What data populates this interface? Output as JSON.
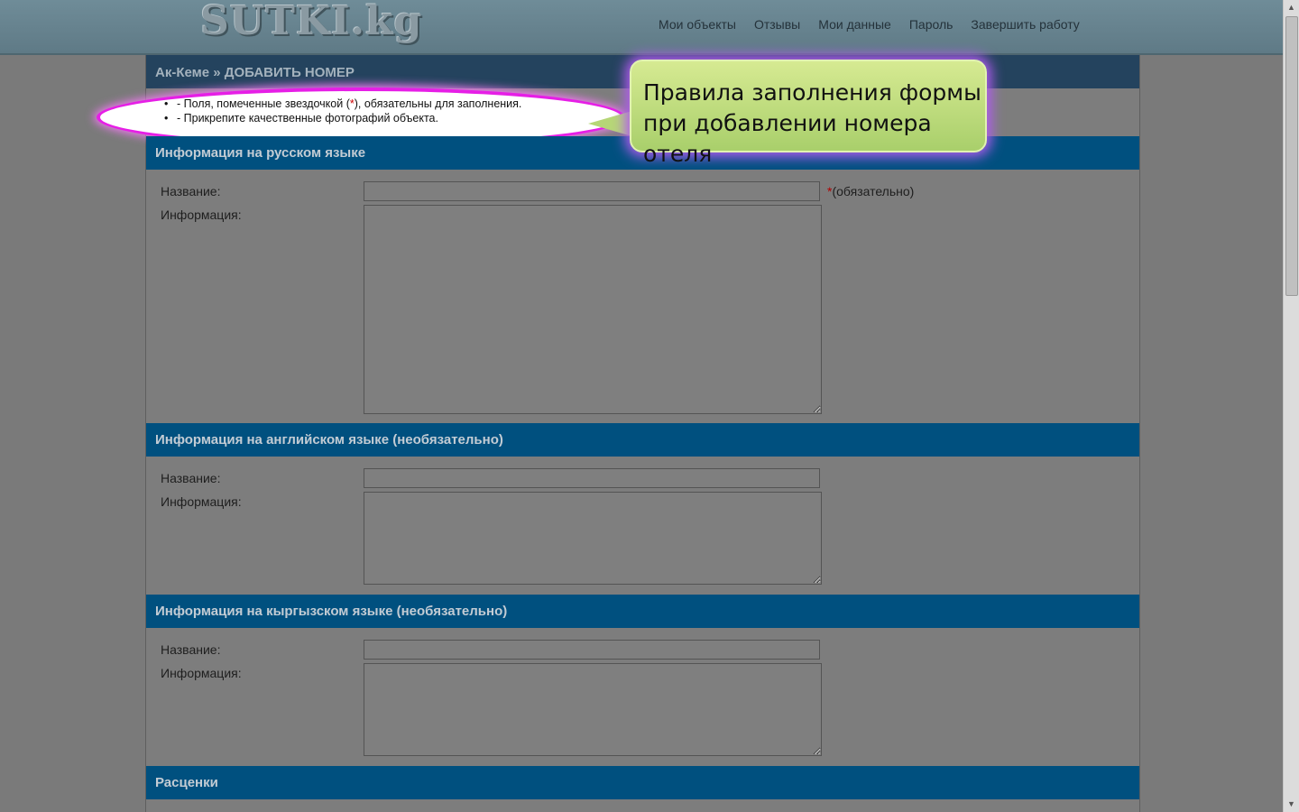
{
  "header": {
    "logo": "SUTKI.kg",
    "nav": [
      "Мои объекты",
      "Отзывы",
      "Мои данные",
      "Пароль",
      "Завершить работу"
    ]
  },
  "breadcrumb": {
    "parent": "Ак-Кеме",
    "separator": "»",
    "current": "ДОБАВИТЬ НОМЕР"
  },
  "rules": {
    "line1_pre": "- Поля, помеченные звездочкой (",
    "line1_star": "*",
    "line1_post": "), обязательны для заполнения.",
    "line2": "- Прикрепите качественные фотографий объекта."
  },
  "callout": {
    "line1": "Правила заполнения формы",
    "line2": "при добавлении номера отеля"
  },
  "sections": {
    "ru": {
      "title": "Информация на русском языке",
      "name_label": "Название:",
      "info_label": "Информация:",
      "name_value": "",
      "info_value": "",
      "required_star": "*",
      "required_text": "(обязательно)"
    },
    "en": {
      "title": "Информация на английском языке (необязательно)",
      "name_label": "Название:",
      "info_label": "Информация:",
      "name_value": "",
      "info_value": ""
    },
    "ky": {
      "title": "Информация на кыргызском языке (необязательно)",
      "name_label": "Название:",
      "info_label": "Информация:",
      "name_value": "",
      "info_value": ""
    },
    "prices": {
      "title": "Расценки"
    }
  },
  "colors": {
    "section_bar": "#00507f",
    "breadcrumb_bar": "#24435e",
    "highlight": "#e61ee6",
    "callout": "#c5e085"
  }
}
